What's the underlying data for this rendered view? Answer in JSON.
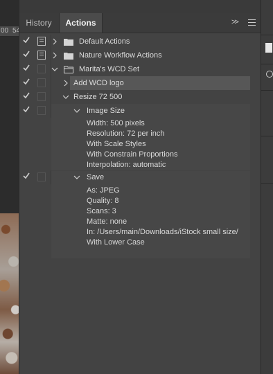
{
  "ruler": {
    "marks": [
      "00",
      "54"
    ]
  },
  "tabs": [
    {
      "label": "History",
      "active": false
    },
    {
      "label": "Actions",
      "active": true
    }
  ],
  "panel_buttons": {
    "expand": "»"
  },
  "actions": [
    {
      "name": "Default Actions",
      "checked": true,
      "dialog": true,
      "type": "set",
      "expanded": false
    },
    {
      "name": "Nature Workflow Actions",
      "checked": true,
      "dialog": true,
      "type": "set",
      "expanded": false
    },
    {
      "name": "Marita's WCD Set",
      "checked": true,
      "dialog": false,
      "type": "set",
      "expanded": true
    },
    {
      "name": "Add WCD logo",
      "checked": true,
      "dialog": false,
      "type": "action",
      "expanded": false,
      "selected": true
    },
    {
      "name": "Resize 72 500",
      "checked": true,
      "dialog": false,
      "type": "action",
      "expanded": true
    },
    {
      "name": "Image Size",
      "checked": true,
      "dialog": false,
      "type": "step",
      "expanded": true,
      "details": [
        "Width: 500 pixels",
        "Resolution: 72 per inch",
        "With Scale Styles",
        "With Constrain Proportions",
        "Interpolation: automatic"
      ]
    },
    {
      "name": "Save",
      "checked": true,
      "dialog": false,
      "type": "step",
      "expanded": true,
      "details": [
        "As: JPEG",
        "Quality: 8",
        "Scans: 3",
        "Matte: none",
        "In: /Users/main/Downloads/iStock small size/",
        "With Lower Case"
      ]
    }
  ],
  "colors": {
    "panel": "#434343",
    "selected_row": "#575757",
    "text": "#dcdcdc"
  }
}
